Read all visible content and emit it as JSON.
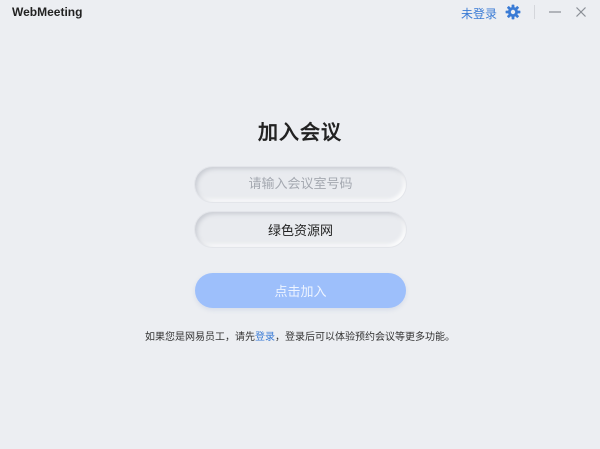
{
  "window": {
    "app_title": "WebMeeting",
    "login_status": "未登录"
  },
  "icons": {
    "settings": "gear-icon",
    "minimize": "minimize-icon",
    "close": "close-icon"
  },
  "colors": {
    "accent": "#3a7bd5",
    "join_button_bg": "#9dbffb",
    "background": "#eceef2"
  },
  "main": {
    "heading": "加入会议",
    "meeting_id": {
      "value": "",
      "placeholder": "请输入会议室号码"
    },
    "display_name": {
      "value": "绿色资源网"
    },
    "join_label": "点击加入",
    "hint": {
      "prefix": "如果您是网易员工，请先",
      "link": "登录",
      "suffix": "，登录后可以体验预约会议等更多功能。"
    }
  }
}
